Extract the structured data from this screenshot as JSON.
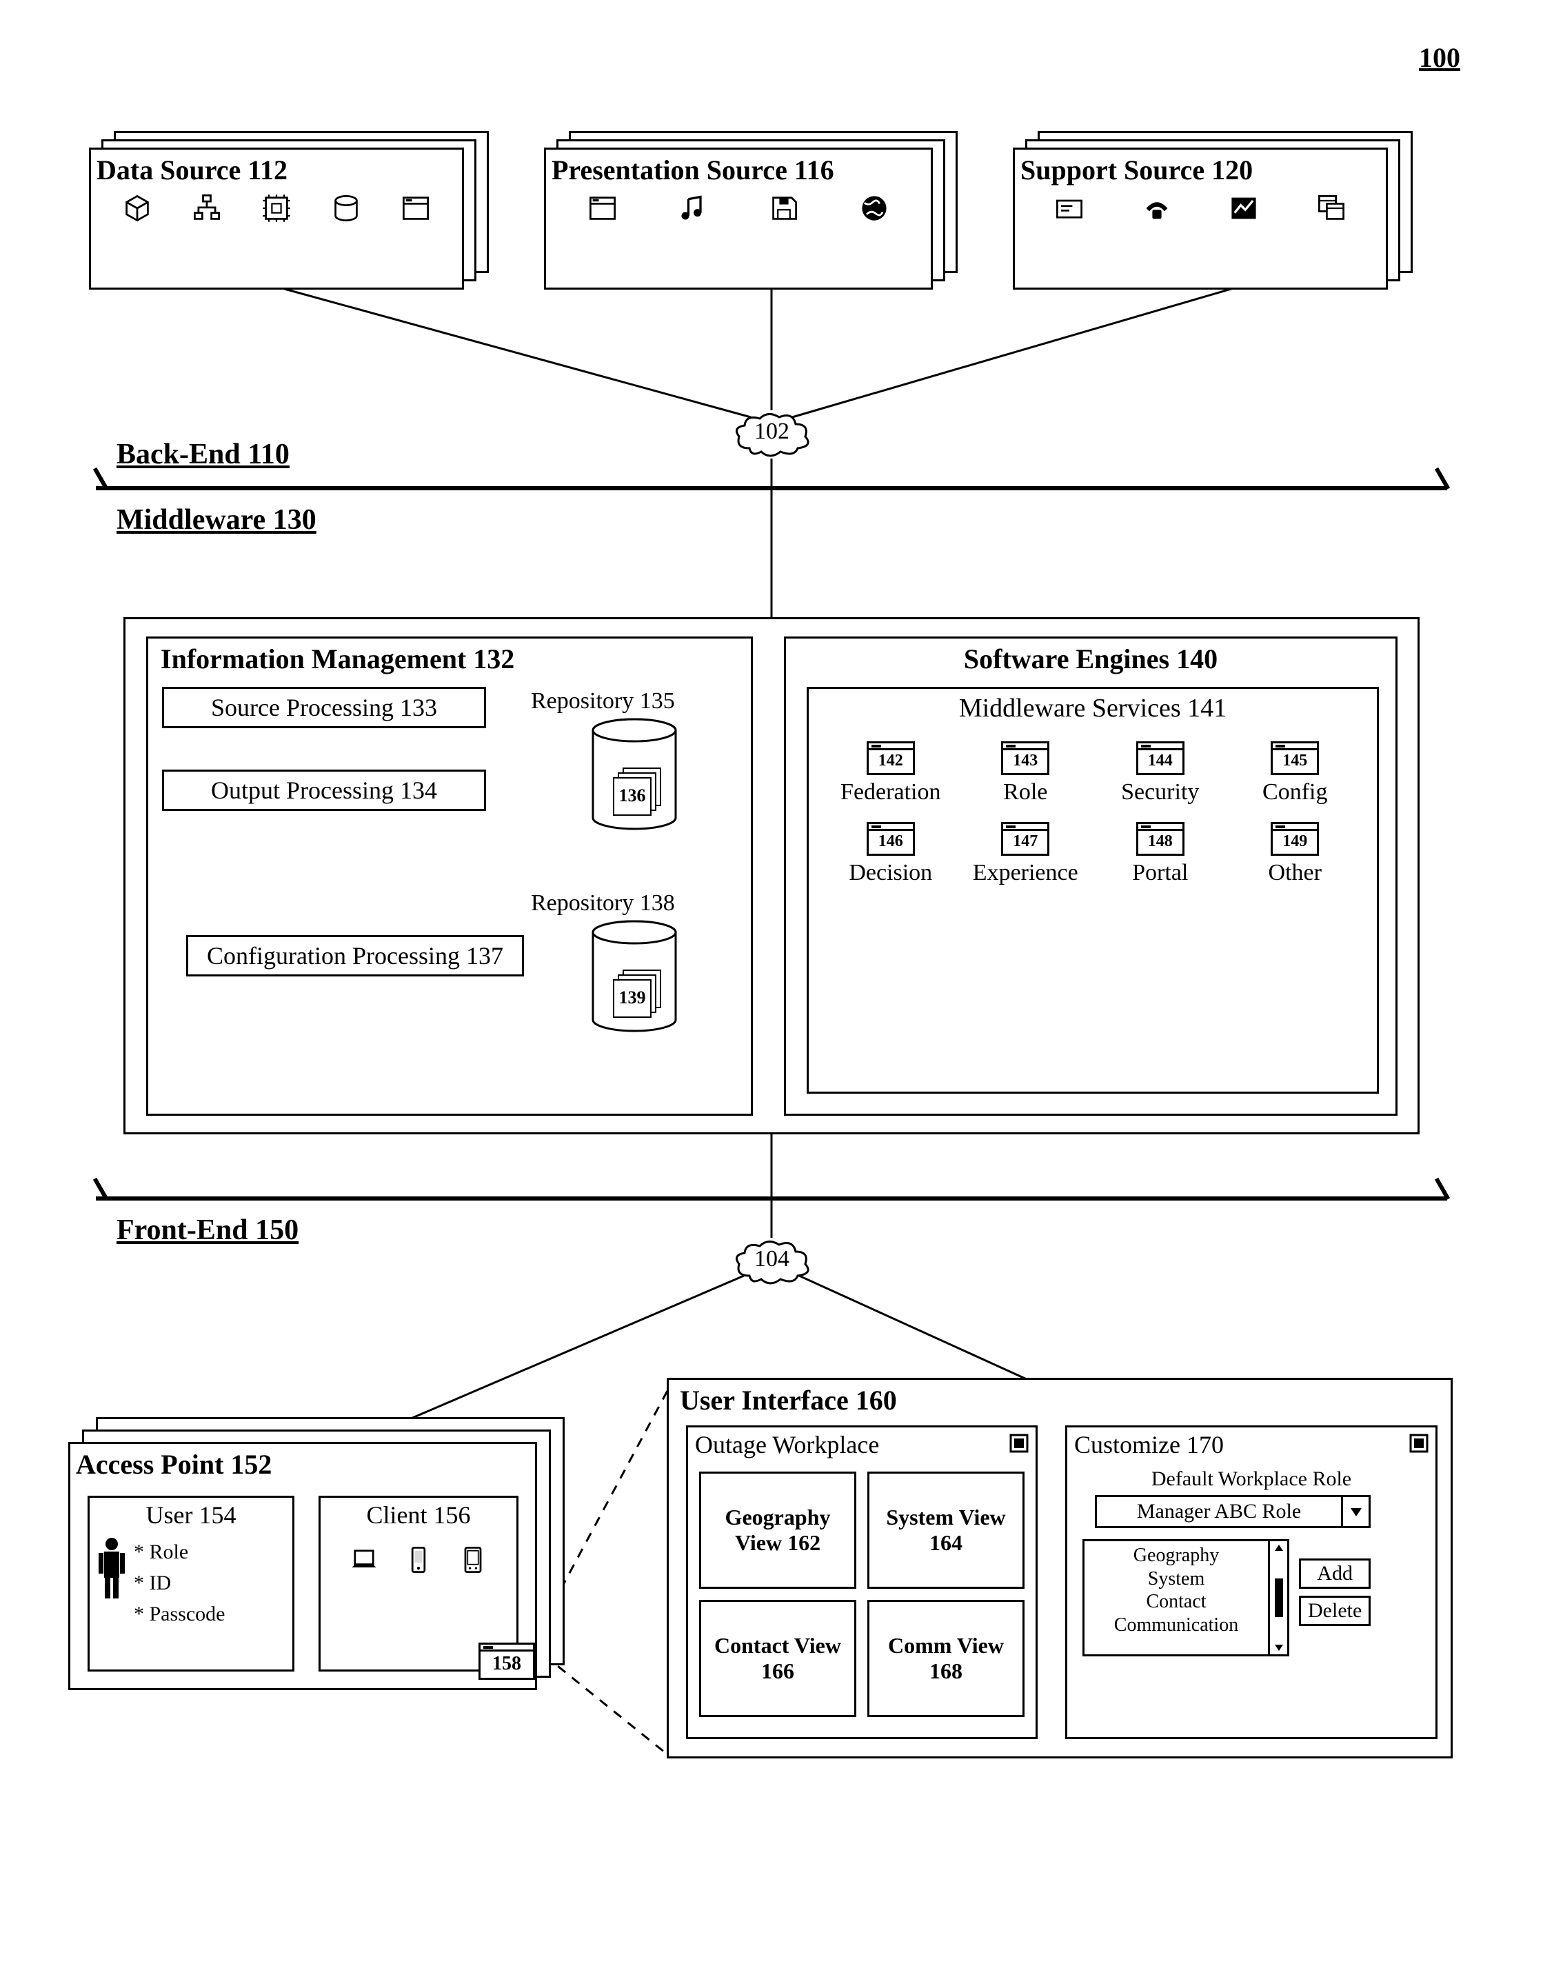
{
  "figure_number": "100",
  "backend": {
    "label": "Back-End 110",
    "data_source": {
      "title": "Data Source 112"
    },
    "presentation_source": {
      "title": "Presentation Source 116"
    },
    "support_source": {
      "title": "Support Source 120"
    },
    "cloud": "102"
  },
  "middleware": {
    "label": "Middleware 130",
    "info_mgmt": {
      "title": "Information Management 132",
      "source_processing": "Source Processing 133",
      "output_processing": "Output Processing 134",
      "config_processing": "Configuration Processing 137",
      "repo1_label": "Repository 135",
      "repo1_item": "136",
      "repo2_label": "Repository 138",
      "repo2_item": "139"
    },
    "engines": {
      "title": "Software Engines 140",
      "services_label": "Middleware Services 141",
      "items": [
        {
          "num": "142",
          "label": "Federation"
        },
        {
          "num": "143",
          "label": "Role"
        },
        {
          "num": "144",
          "label": "Security"
        },
        {
          "num": "145",
          "label": "Config"
        },
        {
          "num": "146",
          "label": "Decision"
        },
        {
          "num": "147",
          "label": "Experience"
        },
        {
          "num": "148",
          "label": "Portal"
        },
        {
          "num": "149",
          "label": "Other"
        }
      ]
    }
  },
  "frontend": {
    "label": "Front-End 150",
    "cloud": "104",
    "access_point": {
      "title": "Access Point 152",
      "user_title": "User 154",
      "user_attrs": [
        "* Role",
        "* ID",
        "* Passcode"
      ],
      "client_title": "Client 156",
      "client_window": "158"
    },
    "ui": {
      "title": "User Interface 160",
      "outage": {
        "title": "Outage Workplace",
        "views": [
          "Geography View 162",
          "System View 164",
          "Contact View 166",
          "Comm View 168"
        ]
      },
      "customize": {
        "title": "Customize 170",
        "default_label": "Default Workplace Role",
        "dropdown_value": "Manager ABC Role",
        "list_items": [
          "Geography",
          "System",
          "Contact",
          "Communication"
        ],
        "add_btn": "Add",
        "delete_btn": "Delete"
      }
    }
  }
}
